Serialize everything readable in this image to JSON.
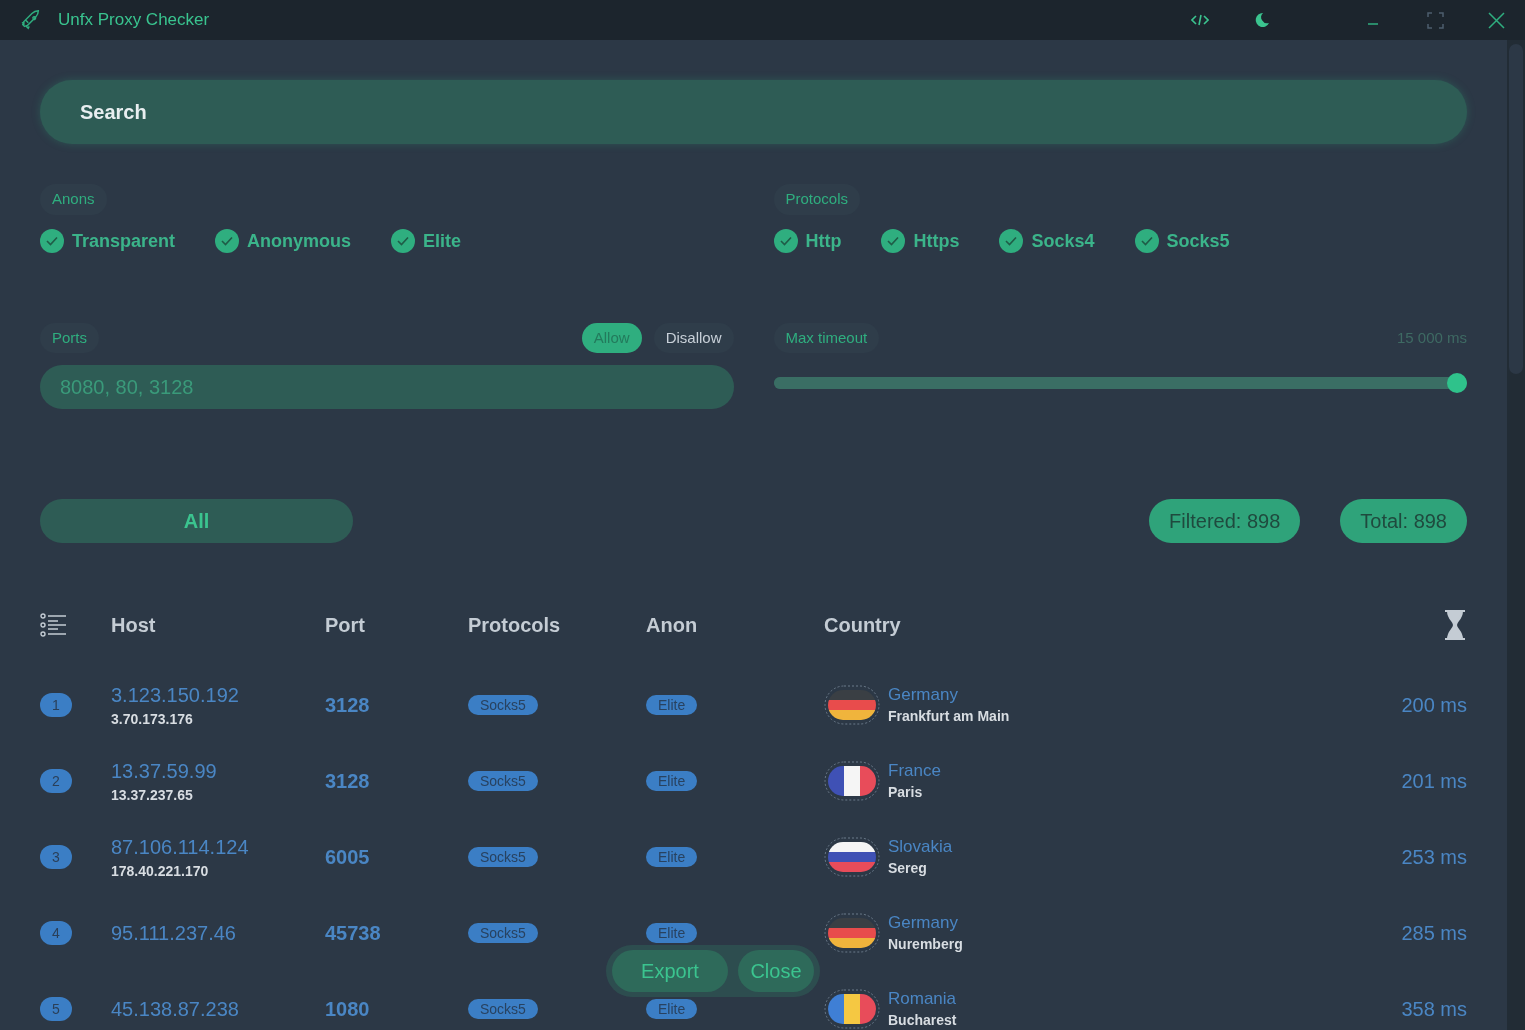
{
  "window": {
    "title": "Unfx Proxy Checker"
  },
  "search": {
    "placeholder": "Search"
  },
  "anons": {
    "label": "Anons",
    "options": [
      {
        "label": "Transparent",
        "checked": true
      },
      {
        "label": "Anonymous",
        "checked": true
      },
      {
        "label": "Elite",
        "checked": true
      }
    ]
  },
  "protocols": {
    "label": "Protocols",
    "options": [
      {
        "label": "Http",
        "checked": true
      },
      {
        "label": "Https",
        "checked": true
      },
      {
        "label": "Socks4",
        "checked": true
      },
      {
        "label": "Socks5",
        "checked": true
      }
    ]
  },
  "ports": {
    "label": "Ports",
    "modes": [
      {
        "label": "Allow",
        "selected": true
      },
      {
        "label": "Disallow",
        "selected": false
      }
    ],
    "placeholder": "8080, 80, 3128"
  },
  "timeout": {
    "label": "Max timeout",
    "reading": "15 000 ms",
    "level": 1
  },
  "filter": {
    "label": "All"
  },
  "counts": [
    "Filtered: 898",
    "Total: 898"
  ],
  "table": {
    "columns": [
      "Host",
      "Port",
      "Protocols",
      "Anon",
      "Country"
    ],
    "rows": [
      {
        "index": "1",
        "host": "3.123.150.192",
        "real_ip": "3.70.173.176",
        "port": "3128",
        "protocol": "Socks5",
        "anon": "Elite",
        "country": "Germany",
        "city": "Frankfurt am Main",
        "time": "200 ms",
        "flag": {
          "kind": "horizontal",
          "stripes": [
            {
              "color": "#3a3f44"
            },
            {
              "color": "#e84c4c"
            },
            {
              "color": "#f0b43c"
            }
          ]
        }
      },
      {
        "index": "2",
        "host": "13.37.59.99",
        "real_ip": "13.37.237.65",
        "port": "3128",
        "protocol": "Socks5",
        "anon": "Elite",
        "country": "France",
        "city": "Paris",
        "time": "201 ms",
        "flag": {
          "kind": "vertical",
          "stripes": [
            {
              "color": "#3f51b5"
            },
            {
              "color": "#f5f5f5"
            },
            {
              "color": "#e84c5a"
            }
          ]
        }
      },
      {
        "index": "3",
        "host": "87.106.114.124",
        "real_ip": "178.40.221.170",
        "port": "6005",
        "protocol": "Socks5",
        "anon": "Elite",
        "country": "Slovakia",
        "city": "Sereg",
        "time": "253 ms",
        "flag": {
          "kind": "horizontal",
          "stripes": [
            {
              "color": "#f5f5f5"
            },
            {
              "color": "#3f51b5"
            },
            {
              "color": "#e84c5a"
            }
          ]
        }
      },
      {
        "index": "4",
        "host": "95.111.237.46",
        "port": "45738",
        "protocol": "Socks5",
        "anon": "Elite",
        "country": "Germany",
        "city": "Nuremberg",
        "time": "285 ms",
        "flag": {
          "kind": "horizontal",
          "stripes": [
            {
              "color": "#3a3f44"
            },
            {
              "color": "#e84c4c"
            },
            {
              "color": "#f0b43c"
            }
          ]
        }
      },
      {
        "index": "5",
        "host": "45.138.87.238",
        "port": "1080",
        "protocol": "Socks5",
        "anon": "Elite",
        "country": "Romania",
        "city": "Bucharest",
        "time": "358 ms",
        "flag": {
          "kind": "vertical",
          "stripes": [
            {
              "color": "#3f7fd5"
            },
            {
              "color": "#f5c842"
            },
            {
              "color": "#e84c5a"
            }
          ]
        }
      }
    ]
  },
  "actions": [
    "Export",
    "Close"
  ]
}
